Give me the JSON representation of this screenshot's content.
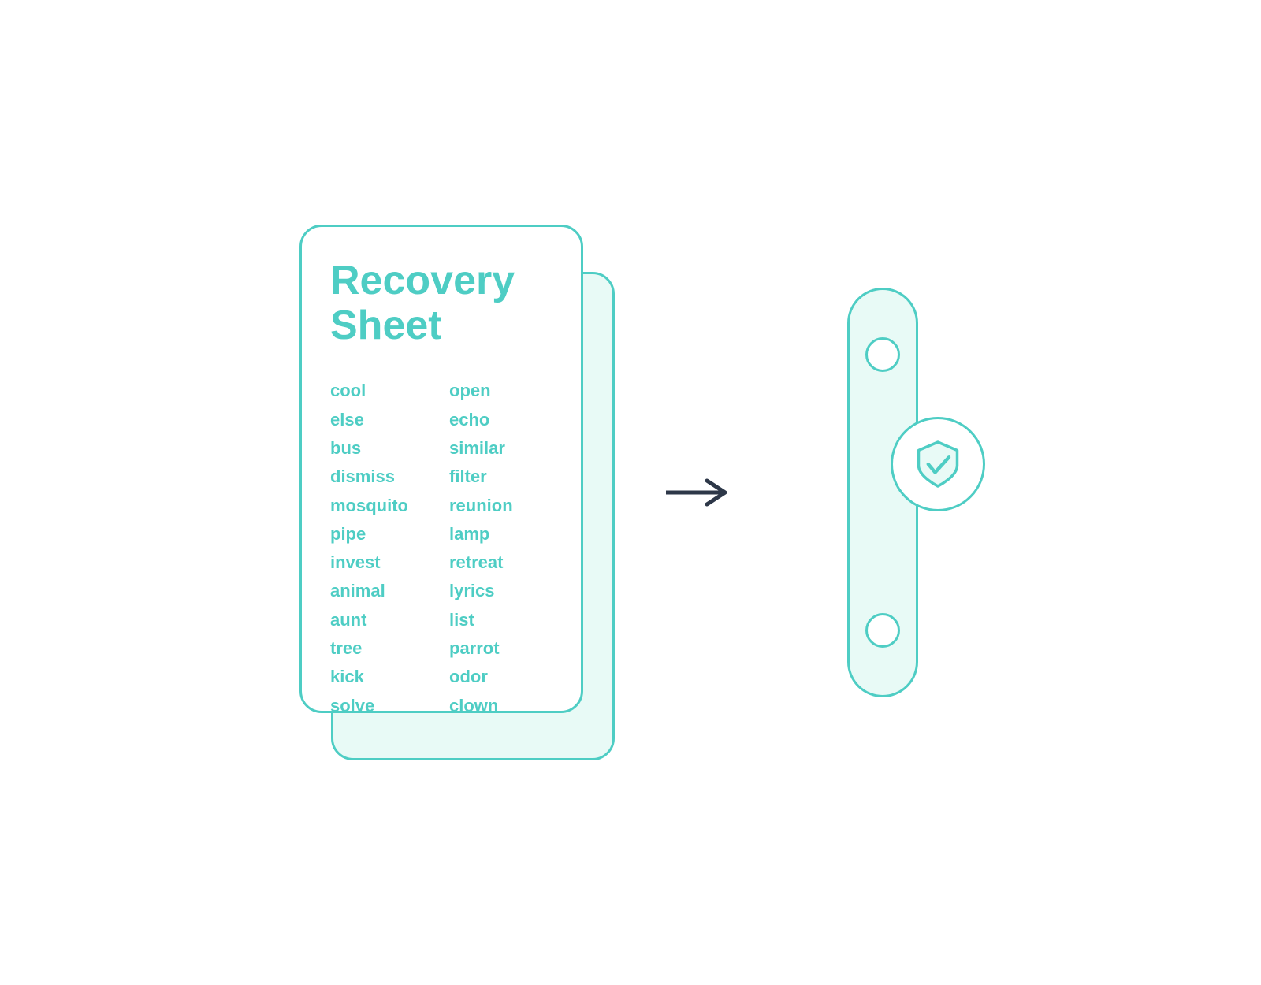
{
  "card": {
    "title_line1": "Recovery",
    "title_line2": "Sheet",
    "words_col1": [
      "cool",
      "else",
      "bus",
      "dismiss",
      "mosquito",
      "pipe",
      "invest",
      "animal",
      "aunt",
      "tree",
      "kick",
      "solve"
    ],
    "words_col2": [
      "open",
      "echo",
      "similar",
      "filter",
      "reunion",
      "lamp",
      "retreat",
      "lyrics",
      "list",
      "parrot",
      "odor",
      "clown"
    ]
  },
  "arrow": "→",
  "colors": {
    "teal": "#4ecdc4",
    "dark": "#2d3748",
    "bg_light": "#e8faf6",
    "white": "#ffffff"
  }
}
